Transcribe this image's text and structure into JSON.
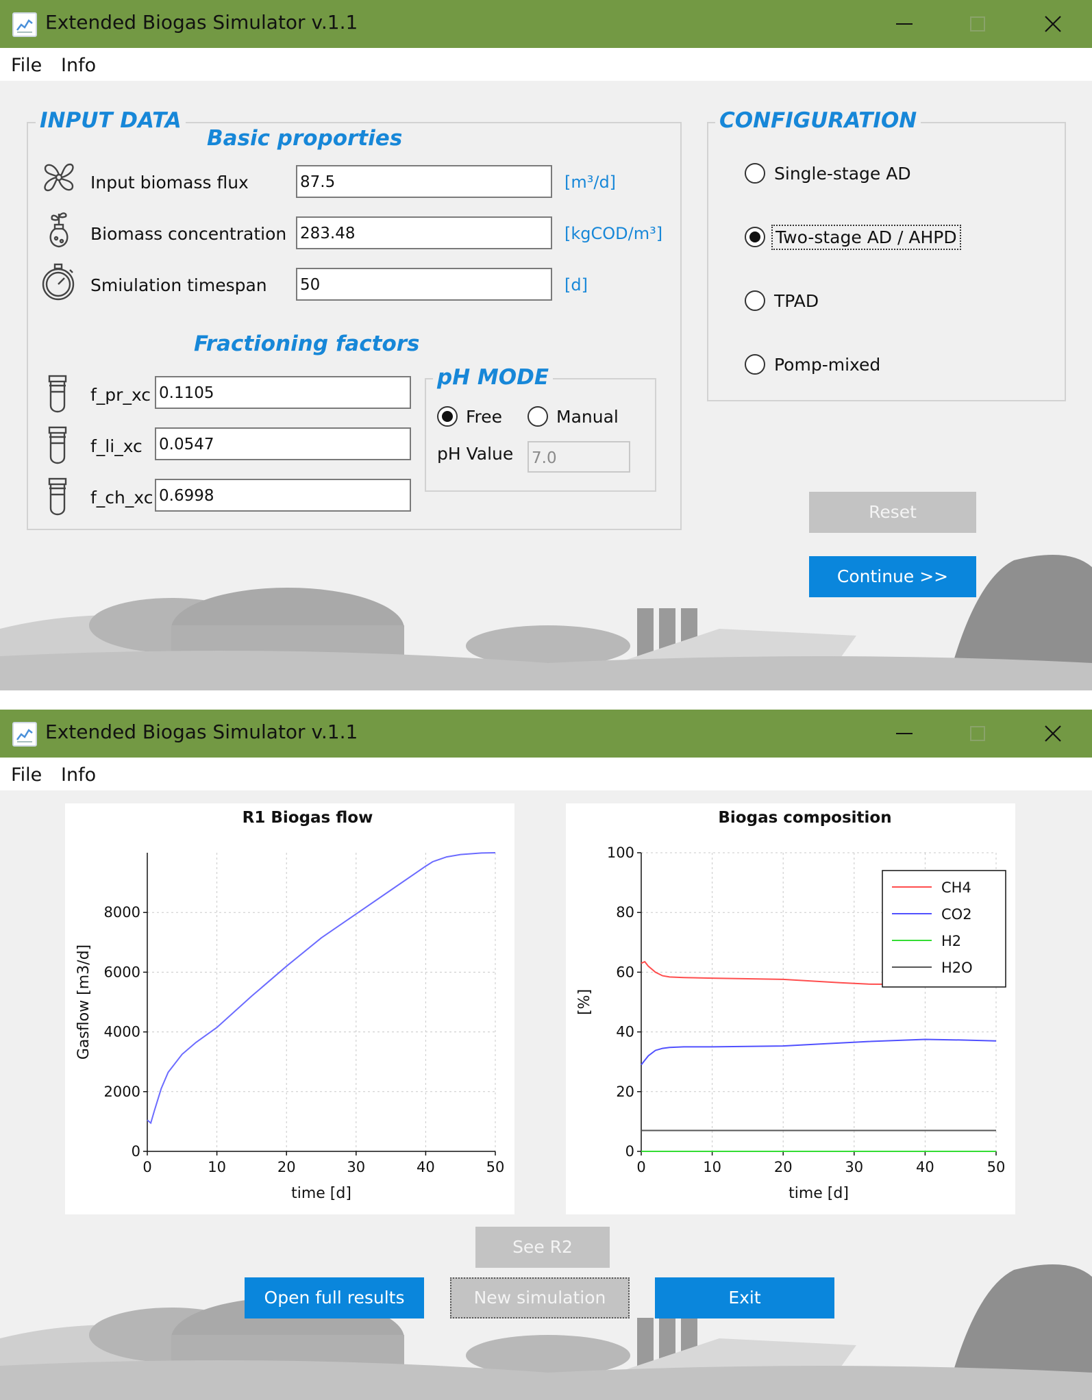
{
  "window": {
    "title": "Extended Biogas Simulator v.1.1",
    "menu": [
      "File",
      "Info"
    ]
  },
  "input": {
    "group_title": "INPUT DATA",
    "basic_title": "Basic proporties",
    "rows": [
      {
        "icon": "fan-icon",
        "label": "Input biomass flux",
        "value": "87.5",
        "unit": "[m³/d]"
      },
      {
        "icon": "plant-flask-icon",
        "label": "Biomass concentration",
        "value": "283.48",
        "unit": "[kgCOD/m³]"
      },
      {
        "icon": "stopwatch-icon",
        "label": "Smiulation timespan",
        "value": "50",
        "unit": "[d]"
      }
    ],
    "fractioning_title": "Fractioning factors",
    "factors": [
      {
        "label": "f_pr_xc",
        "value": "0.1105"
      },
      {
        "label": "f_li_xc",
        "value": "0.0547"
      },
      {
        "label": "f_ch_xc",
        "value": "0.6998"
      }
    ]
  },
  "ph": {
    "title": "pH MODE",
    "options": [
      {
        "label": "Free",
        "checked": true
      },
      {
        "label": "Manual",
        "checked": false
      }
    ],
    "value_label": "pH Value",
    "value": "7.0"
  },
  "configuration": {
    "title": "CONFIGURATION",
    "options": [
      {
        "label": "Single-stage AD",
        "checked": false
      },
      {
        "label": "Two-stage AD / AHPD",
        "checked": true
      },
      {
        "label": "TPAD",
        "checked": false
      },
      {
        "label": "Pomp-mixed",
        "checked": false
      }
    ]
  },
  "buttons1": {
    "reset": "Reset",
    "continue": "Continue >>"
  },
  "buttons2": {
    "see_r2": "See R2",
    "open_full": "Open full results",
    "new_sim": "New simulation",
    "exit": "Exit"
  },
  "chart_data": [
    {
      "type": "line",
      "title": "R1 Biogas flow",
      "xlabel": "time [d]",
      "ylabel": "Gasflow  [m3/d]",
      "xlim": [
        0,
        50
      ],
      "ylim": [
        0,
        10000
      ],
      "xticks": [
        0,
        10,
        20,
        30,
        40,
        50
      ],
      "yticks": [
        0,
        2000,
        4000,
        6000,
        8000
      ],
      "grid": true,
      "series": [
        {
          "color": "#6b6bff",
          "x": [
            0,
            0.5,
            1,
            2,
            3,
            5,
            7,
            10,
            15,
            20,
            25,
            30,
            35,
            40,
            41,
            43,
            45,
            48,
            50
          ],
          "y": [
            1050,
            950,
            1350,
            2100,
            2650,
            3250,
            3650,
            4150,
            5200,
            6200,
            7150,
            7950,
            8750,
            9550,
            9700,
            9860,
            9940,
            9990,
            10000
          ]
        }
      ]
    },
    {
      "type": "line",
      "title": "Biogas composition",
      "xlabel": "time [d]",
      "ylabel": "[%]",
      "xlim": [
        0,
        50
      ],
      "ylim": [
        0,
        100
      ],
      "xticks": [
        0,
        10,
        20,
        30,
        40,
        50
      ],
      "yticks": [
        0,
        20,
        40,
        60,
        80,
        100
      ],
      "grid": true,
      "legend": "top-right",
      "series": [
        {
          "name": "CH4",
          "color": "#ff4d4d",
          "x": [
            0,
            0.5,
            1,
            2,
            3,
            4,
            6,
            10,
            20,
            28,
            32,
            40,
            50
          ],
          "y": [
            63,
            63.5,
            62,
            60,
            58.8,
            58.4,
            58.2,
            58,
            57.6,
            56.5,
            56,
            55.9,
            56
          ]
        },
        {
          "name": "CO2",
          "color": "#5050ff",
          "x": [
            0,
            0.5,
            1,
            2,
            3,
            4,
            6,
            10,
            20,
            28,
            32,
            40,
            45,
            50
          ],
          "y": [
            29,
            30.5,
            32,
            33.8,
            34.5,
            34.8,
            35,
            35,
            35.3,
            36.3,
            36.8,
            37.5,
            37.3,
            37
          ]
        },
        {
          "name": "H2",
          "color": "#33dd33",
          "x": [
            0,
            50
          ],
          "y": [
            0,
            0
          ]
        },
        {
          "name": "H2O",
          "color": "#555555",
          "x": [
            0,
            50
          ],
          "y": [
            7,
            7
          ]
        }
      ]
    }
  ]
}
